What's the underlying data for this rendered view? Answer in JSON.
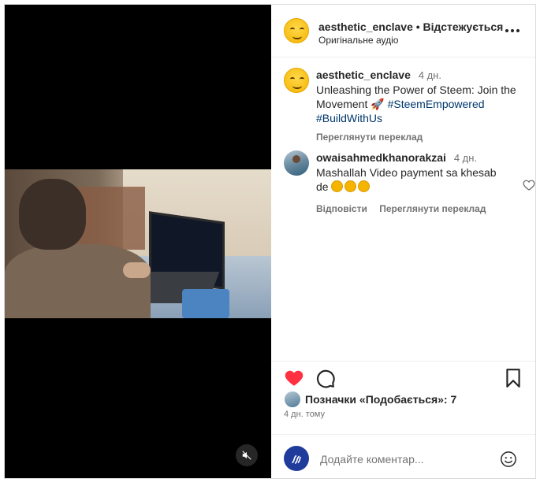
{
  "header": {
    "username": "aesthetic_enclave",
    "separator": "•",
    "follow_label": "Відстежується",
    "audio_label": "Оригінальне аудіо"
  },
  "caption": {
    "username": "aesthetic_enclave",
    "time": "4 дн.",
    "text": "Unleashing the Power of Steem: Join the Movement 🚀",
    "hashtag1": "#SteemEmpowered",
    "hashtag2": "#BuildWithUs",
    "translate_label": "Переглянути переклад"
  },
  "comment": {
    "username": "owaisahmedkhanorakzai",
    "time": "4 дн.",
    "text": "Mashallah Video payment sa khesab de",
    "reply_label": "Відповісти",
    "translate_label": "Переглянути переклад"
  },
  "likes": {
    "text": "Позначки «Подобається»: 7"
  },
  "post_time": "4 дн. тому",
  "add_comment": {
    "placeholder": "Додайте коментар..."
  },
  "icons": {
    "more": "more-options-icon",
    "like": "heart-icon",
    "comment": "comment-icon",
    "save": "bookmark-icon",
    "mute": "mute-icon",
    "emoji": "emoji-icon"
  },
  "colors": {
    "heart": "#ff3040",
    "link": "#00376b",
    "secondary_text": "#737373"
  }
}
